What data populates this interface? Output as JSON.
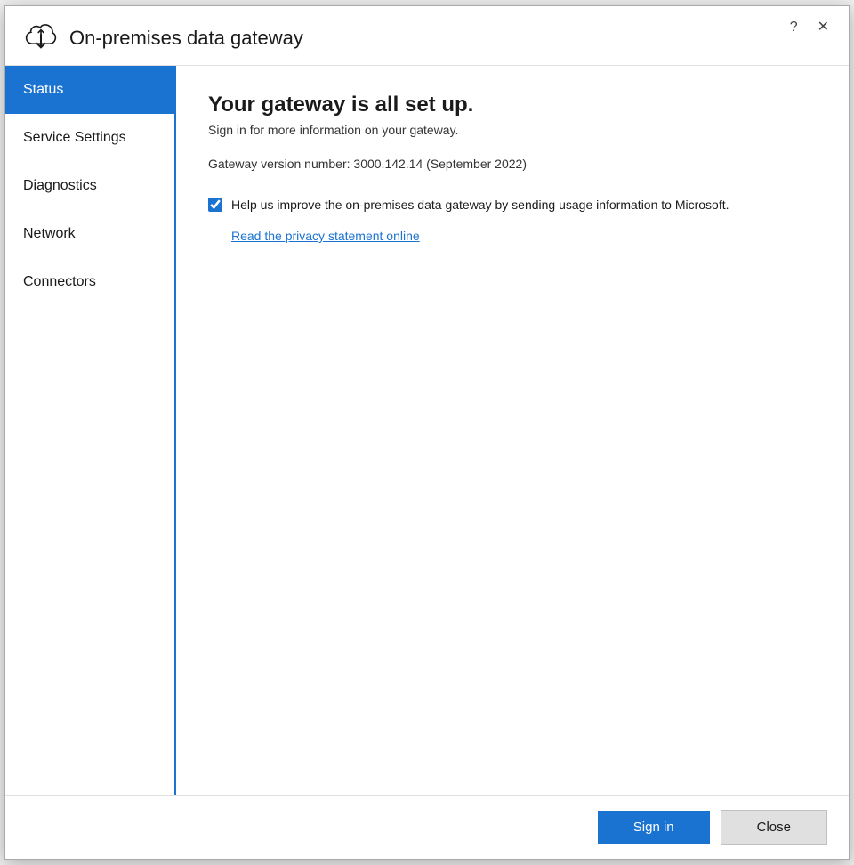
{
  "window": {
    "title": "On-premises data gateway",
    "help_button": "?",
    "close_button": "✕"
  },
  "sidebar": {
    "items": [
      {
        "id": "status",
        "label": "Status",
        "active": true
      },
      {
        "id": "service-settings",
        "label": "Service Settings",
        "active": false
      },
      {
        "id": "diagnostics",
        "label": "Diagnostics",
        "active": false
      },
      {
        "id": "network",
        "label": "Network",
        "active": false
      },
      {
        "id": "connectors",
        "label": "Connectors",
        "active": false
      }
    ]
  },
  "content": {
    "heading": "Your gateway is all set up.",
    "subtext": "Sign in for more information on your gateway.",
    "version_label": "Gateway version number: 3000.142.14 (September 2022)",
    "checkbox_label": "Help us improve the on-premises data gateway by sending usage information to Microsoft.",
    "privacy_link": "Read the privacy statement online",
    "checkbox_checked": true
  },
  "footer": {
    "sign_in_label": "Sign in",
    "close_label": "Close"
  },
  "colors": {
    "accent": "#1a73d1",
    "active_nav_bg": "#1a73d1",
    "active_nav_text": "#ffffff"
  }
}
